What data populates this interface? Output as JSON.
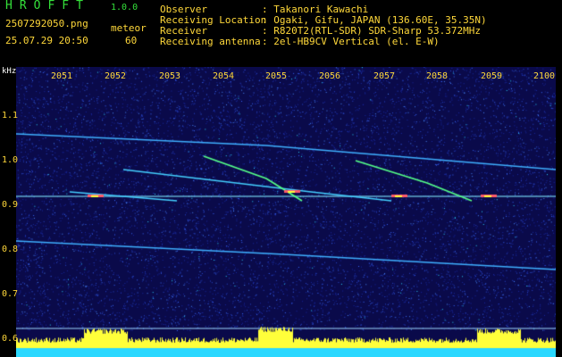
{
  "app": {
    "name": "HROFFT",
    "version": "1.0.0"
  },
  "image": {
    "filename": "2507292050.png",
    "datetime": "25.07.29 20:50"
  },
  "meteor": {
    "label": "meteor",
    "count": "60"
  },
  "info": {
    "observer_label": "Observer",
    "observer": ": Takanori Kawachi",
    "location_label": "Receiving Location",
    "location": ": Ogaki, Gifu, JAPAN (136.60E, 35.35N)",
    "receiver_label": "Receiver",
    "receiver": ": R820T2(RTL-SDR) SDR-Sharp 53.372MHz",
    "antenna_label": "Receiving antenna",
    "antenna": ": 2el-HB9CV Vertical (el. E-W)"
  },
  "axis": {
    "unit": "kHz",
    "y_ticks": [
      "1.1",
      "1.0",
      "0.9",
      "0.8",
      "0.7",
      "0.6"
    ],
    "x_ticks": [
      "2051",
      "2052",
      "2053",
      "2054",
      "2055",
      "2056",
      "2057",
      "2058",
      "2059",
      "2100"
    ]
  },
  "colors": {
    "background": "#0a0a4a",
    "header_text": "#ffd83a",
    "brand": "#34e03a",
    "amplitude": "#ffff3a",
    "baseline": "#2ad8ff"
  }
}
